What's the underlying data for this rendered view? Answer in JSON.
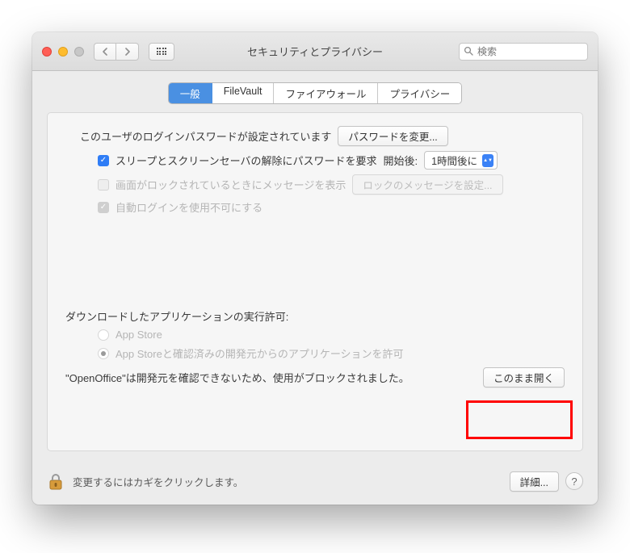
{
  "window": {
    "title": "セキュリティとプライバシー"
  },
  "search": {
    "placeholder": "検索"
  },
  "tabs": {
    "general": "一般",
    "filevault": "FileVault",
    "firewall": "ファイアウォール",
    "privacy": "プライバシー"
  },
  "login": {
    "password_set_text": "このユーザのログインパスワードが設定されています",
    "change_password_btn": "パスワードを変更...",
    "require_password_label": "スリープとスクリーンセーバの解除にパスワードを要求",
    "after_label": "開始後:",
    "after_value": "1時間後に",
    "show_message_label": "画面がロックされているときにメッセージを表示",
    "set_lock_message_btn": "ロックのメッセージを設定...",
    "disable_autologin_label": "自動ログインを使用不可にする"
  },
  "download": {
    "heading": "ダウンロードしたアプリケーションの実行許可:",
    "opt_appstore": "App Store",
    "opt_identified": "App Storeと確認済みの開発元からのアプリケーションを許可",
    "blocked_text": "\"OpenOffice\"は開発元を確認できないため、使用がブロックされました。",
    "open_anyway_btn": "このまま開く"
  },
  "footer": {
    "lock_text": "変更するにはカギをクリックします。",
    "details_btn": "詳細..."
  }
}
